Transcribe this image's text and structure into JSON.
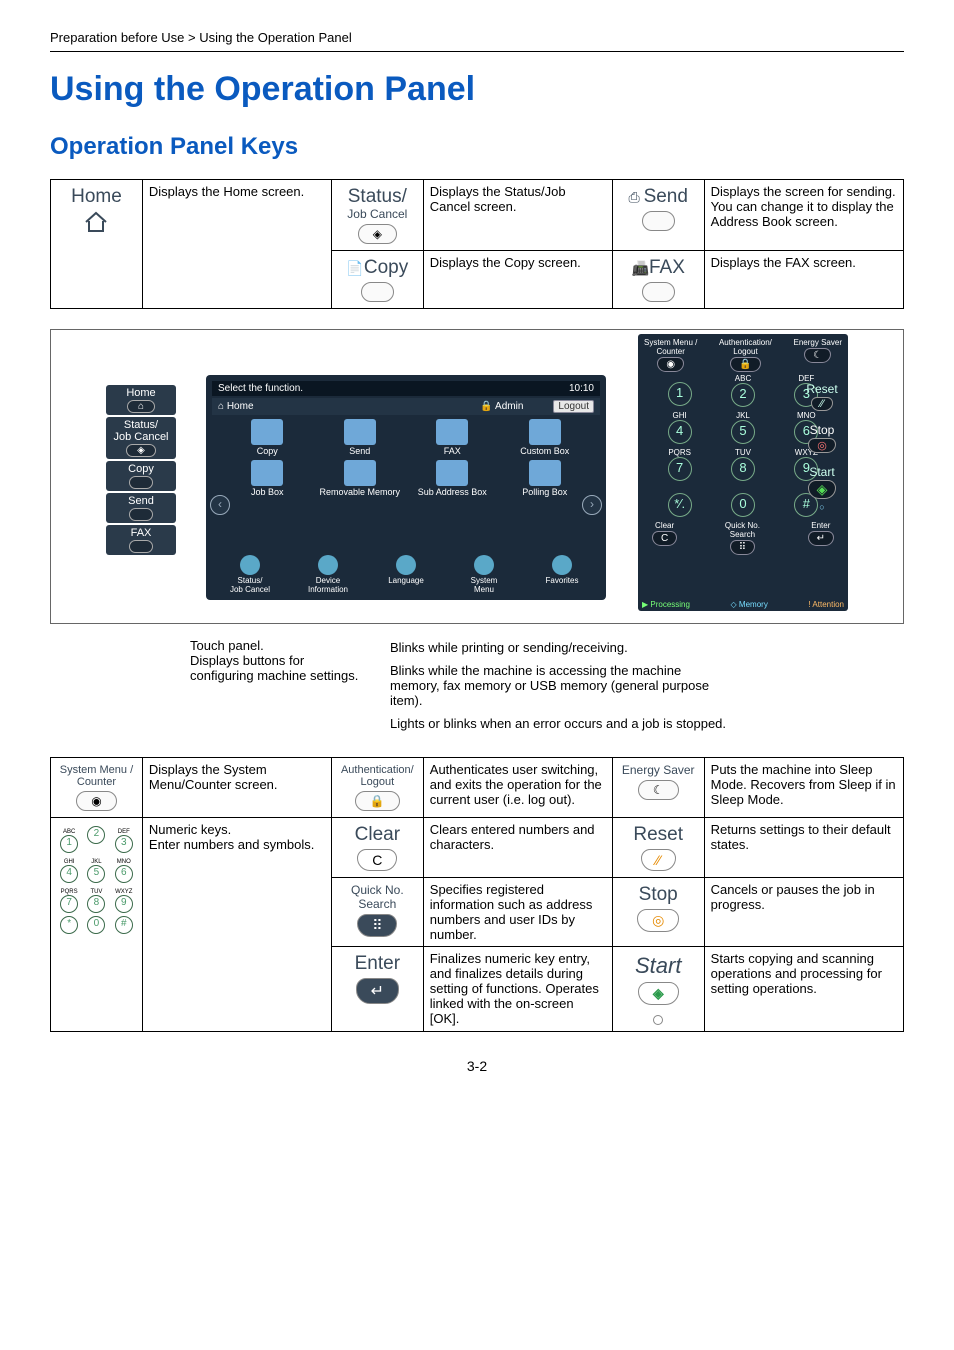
{
  "breadcrumb": "Preparation before Use > Using the Operation Panel",
  "h1": "Using the Operation Panel",
  "h2": "Operation Panel Keys",
  "top_keys": {
    "home": {
      "label": "Home",
      "desc": "Displays the Home screen."
    },
    "status": {
      "label": "Status/",
      "sub": "Job Cancel",
      "desc": "Displays the Status/Job Cancel screen."
    },
    "send": {
      "label": "Send",
      "prefix": "⎙ ",
      "desc": "Displays the screen for sending. You can change it to display the Address Book screen."
    },
    "copy": {
      "label": "Copy",
      "prefix": "📄",
      "desc": "Displays the Copy screen."
    },
    "fax": {
      "label": "FAX",
      "prefix": "📠",
      "desc": "Displays the FAX screen."
    }
  },
  "diagram": {
    "left_keys": [
      "Home",
      "Status/\nJob Cancel",
      "Copy",
      "Send",
      "FAX"
    ],
    "touch": {
      "select": "Select the function.",
      "time": "10:10",
      "home": "Home",
      "admin": "Admin",
      "logout": "Logout",
      "row1": [
        "Copy",
        "Send",
        "FAX",
        "Custom Box"
      ],
      "row2": [
        "Job Box",
        "Removable Memory",
        "Sub Address Box",
        "Polling Box"
      ],
      "bottom": [
        "Status/\nJob Cancel",
        "Device\nInformation",
        "Language",
        "System\nMenu",
        "Favorites"
      ]
    },
    "right": {
      "top": [
        [
          "System Menu /\nCounter"
        ],
        [
          "Authentication/\nLogout"
        ],
        [
          "Energy Saver"
        ]
      ],
      "letters": [
        "ABC",
        "DEF",
        "GHI",
        "JKL",
        "MNO",
        "PQRS",
        "TUV",
        "WXYZ"
      ],
      "nums": [
        "1",
        "2",
        "3",
        "4",
        "5",
        "6",
        "7",
        "8",
        "9",
        "*⁄.",
        "0",
        "#"
      ],
      "side": [
        "Reset",
        "Stop",
        "Start"
      ],
      "bottom_row": [
        "Clear",
        "Quick No.\nSearch",
        "Enter"
      ],
      "status": [
        "▶ Processing",
        "◇ Memory",
        "! Attention"
      ]
    }
  },
  "callouts": {
    "c1": "Touch panel.\nDisplays buttons for configuring machine settings.",
    "c2a": "Blinks while printing or sending/receiving.",
    "c2b": "Blinks while the machine is accessing the machine memory, fax memory or USB memory (general purpose item).",
    "c2c": "Lights or blinks when an error occurs and a job is stopped."
  },
  "bottom_keys": {
    "sysmenu": {
      "label": "System Menu /",
      "sub": "Counter",
      "desc": "Displays the System Menu/Counter screen."
    },
    "auth": {
      "label": "Authentication/",
      "sub": "Logout",
      "desc": "Authenticates user switching, and exits the operation for the current user (i.e. log out)."
    },
    "energy": {
      "label": "Energy Saver",
      "desc": "Puts the machine into Sleep Mode. Recovers from Sleep if in Sleep Mode."
    },
    "numeric": {
      "desc": "Numeric keys.\nEnter numbers and symbols."
    },
    "clear": {
      "label": "Clear",
      "glyph": "C",
      "desc": "Clears entered numbers and characters."
    },
    "reset": {
      "label": "Reset",
      "glyph": "⁄⁄",
      "desc": "Returns settings to their default states."
    },
    "quick": {
      "label": "Quick No.",
      "sub": "Search",
      "glyph": "⠿",
      "desc": "Specifies registered information such as address numbers and user IDs by number."
    },
    "stop": {
      "label": "Stop",
      "glyph": "◎",
      "desc": "Cancels or pauses the job in progress."
    },
    "enter": {
      "label": "Enter",
      "glyph": "↵",
      "desc": "Finalizes numeric key entry, and finalizes details during setting of functions. Operates linked with the on-screen [OK]."
    },
    "start": {
      "label": "Start",
      "glyph": "◈",
      "desc": "Starts copying and scanning operations and processing for setting operations."
    }
  },
  "page": "3-2"
}
